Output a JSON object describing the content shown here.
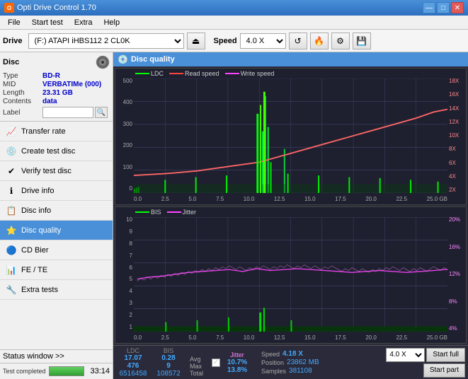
{
  "titlebar": {
    "title": "Opti Drive Control 1.70",
    "minimize": "—",
    "maximize": "□",
    "close": "✕"
  },
  "menu": {
    "items": [
      "File",
      "Start test",
      "Extra",
      "Help"
    ]
  },
  "toolbar": {
    "drive_label": "Drive",
    "drive_value": "(F:) ATAPI iHBS112  2 CL0K",
    "speed_label": "Speed",
    "speed_value": "4.0 X"
  },
  "disc": {
    "title": "Disc",
    "type_label": "Type",
    "type_value": "BD-R",
    "mid_label": "MID",
    "mid_value": "VERBATIMe (000)",
    "length_label": "Length",
    "length_value": "23.31 GB",
    "contents_label": "Contents",
    "contents_value": "data",
    "label_label": "Label",
    "label_value": ""
  },
  "nav": {
    "items": [
      {
        "id": "transfer-rate",
        "label": "Transfer rate",
        "icon": "📈"
      },
      {
        "id": "create-test-disc",
        "label": "Create test disc",
        "icon": "💿"
      },
      {
        "id": "verify-test-disc",
        "label": "Verify test disc",
        "icon": "✔"
      },
      {
        "id": "drive-info",
        "label": "Drive info",
        "icon": "ℹ"
      },
      {
        "id": "disc-info",
        "label": "Disc info",
        "icon": "📋"
      },
      {
        "id": "disc-quality",
        "label": "Disc quality",
        "icon": "⭐",
        "active": true
      },
      {
        "id": "cd-bier",
        "label": "CD Bier",
        "icon": "🔵"
      },
      {
        "id": "fe-te",
        "label": "FE / TE",
        "icon": "📊"
      },
      {
        "id": "extra-tests",
        "label": "Extra tests",
        "icon": "🔧"
      }
    ]
  },
  "status": {
    "window_label": "Status window >>",
    "progress": 100.0,
    "progress_text": "100.0%",
    "time": "33:14",
    "status_text": "Test completed"
  },
  "disc_quality": {
    "title": "Disc quality",
    "chart1": {
      "legend": [
        {
          "label": "LDC",
          "color": "#00ff00"
        },
        {
          "label": "Read speed",
          "color": "#ff4444"
        },
        {
          "label": "Write speed",
          "color": "#ff44ff"
        }
      ],
      "y_left": [
        "500",
        "400",
        "300",
        "200",
        "100",
        "0"
      ],
      "y_right": [
        "18X",
        "16X",
        "14X",
        "12X",
        "10X",
        "8X",
        "6X",
        "4X",
        "2X"
      ],
      "x_labels": [
        "0.0",
        "2.5",
        "5.0",
        "7.5",
        "10.0",
        "12.5",
        "15.0",
        "17.5",
        "20.0",
        "22.5",
        "25.0 GB"
      ]
    },
    "chart2": {
      "legend": [
        {
          "label": "BIS",
          "color": "#00ff00"
        },
        {
          "label": "Jitter",
          "color": "#ff44ff"
        }
      ],
      "y_left": [
        "10",
        "9",
        "8",
        "7",
        "6",
        "5",
        "4",
        "3",
        "2",
        "1"
      ],
      "y_right": [
        "20%",
        "16%",
        "12%",
        "8%",
        "4%"
      ],
      "x_labels": [
        "0.0",
        "2.5",
        "5.0",
        "7.5",
        "10.0",
        "12.5",
        "15.0",
        "17.5",
        "20.0",
        "22.5",
        "25.0 GB"
      ]
    }
  },
  "results": {
    "headers": [
      "",
      "LDC",
      "BIS",
      "",
      "Jitter",
      "Speed",
      ""
    ],
    "avg_label": "Avg",
    "avg_ldc": "17.07",
    "avg_bis": "0.28",
    "avg_jitter": "10.7%",
    "speed_label": "Speed",
    "speed_value": "4.18 X",
    "speed_select": "4.0 X",
    "max_label": "Max",
    "max_ldc": "476",
    "max_bis": "9",
    "max_jitter": "13.8%",
    "position_label": "Position",
    "position_value": "23862 MB",
    "total_label": "Total",
    "total_ldc": "6516458",
    "total_bis": "108572",
    "samples_label": "Samples",
    "samples_value": "381108",
    "jitter_checked": true,
    "jitter_label": "Jitter",
    "start_full_label": "Start full",
    "start_part_label": "Start part"
  }
}
